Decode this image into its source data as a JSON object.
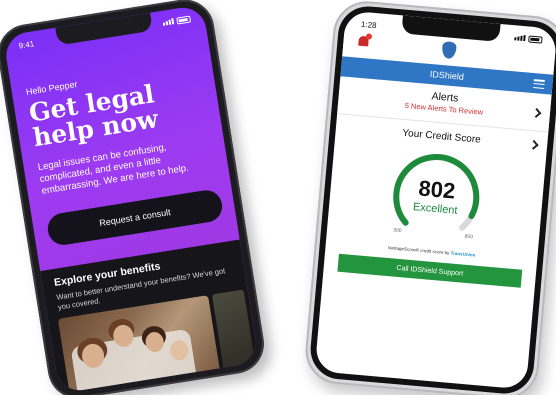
{
  "legal_app": {
    "status_time": "9:41",
    "greeting": "Hello Pepper",
    "headline": "Get legal help now",
    "body": "Legal issues can be confusing, complicated, and even a little embarrassing. We are here to help.",
    "cta_label": "Request a consult",
    "explore_title": "Explore your benefits",
    "explore_subtitle": "Want to better understand your benefits? We've got you covered."
  },
  "idshield_app": {
    "status_time": "1:28",
    "header_title": "IDShield",
    "alerts_title": "Alerts",
    "alerts_subtitle": "5 New Alerts To Review",
    "credit_title": "Your Credit Score",
    "score": "802",
    "score_rating": "Excellent",
    "gauge_min": "300",
    "gauge_max": "850",
    "score_fraction": 0.92,
    "disclaimer": "VantageScore® credit score by",
    "bureau": "TransUnion",
    "call_button": "Call IDShield Support",
    "colors": {
      "header": "#2f77c4",
      "gauge": "#1d8a3c",
      "alert_text": "#d32f2f",
      "call_button": "#24953f"
    }
  }
}
